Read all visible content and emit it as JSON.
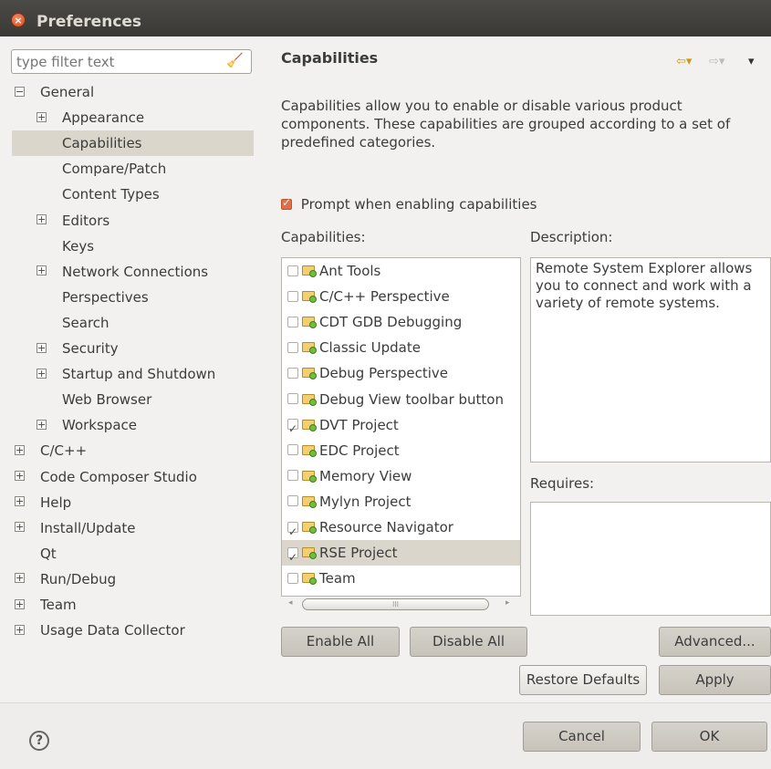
{
  "window": {
    "title": "Preferences"
  },
  "filter": {
    "placeholder": "type filter text"
  },
  "tree": [
    {
      "label": "General",
      "level": 0,
      "expander": "−",
      "selected": false
    },
    {
      "label": "Appearance",
      "level": 1,
      "expander": "+",
      "selected": false
    },
    {
      "label": "Capabilities",
      "level": 1,
      "expander": "",
      "selected": true
    },
    {
      "label": "Compare/Patch",
      "level": 1,
      "expander": "",
      "selected": false
    },
    {
      "label": "Content Types",
      "level": 1,
      "expander": "",
      "selected": false
    },
    {
      "label": "Editors",
      "level": 1,
      "expander": "+",
      "selected": false
    },
    {
      "label": "Keys",
      "level": 1,
      "expander": "",
      "selected": false
    },
    {
      "label": "Network Connections",
      "level": 1,
      "expander": "+",
      "selected": false
    },
    {
      "label": "Perspectives",
      "level": 1,
      "expander": "",
      "selected": false
    },
    {
      "label": "Search",
      "level": 1,
      "expander": "",
      "selected": false
    },
    {
      "label": "Security",
      "level": 1,
      "expander": "+",
      "selected": false
    },
    {
      "label": "Startup and Shutdown",
      "level": 1,
      "expander": "+",
      "selected": false
    },
    {
      "label": "Web Browser",
      "level": 1,
      "expander": "",
      "selected": false
    },
    {
      "label": "Workspace",
      "level": 1,
      "expander": "+",
      "selected": false
    },
    {
      "label": "C/C++",
      "level": 0,
      "expander": "+",
      "selected": false
    },
    {
      "label": "Code Composer Studio",
      "level": 0,
      "expander": "+",
      "selected": false
    },
    {
      "label": "Help",
      "level": 0,
      "expander": "+",
      "selected": false
    },
    {
      "label": "Install/Update",
      "level": 0,
      "expander": "+",
      "selected": false
    },
    {
      "label": "Qt",
      "level": 0,
      "expander": "",
      "selected": false
    },
    {
      "label": "Run/Debug",
      "level": 0,
      "expander": "+",
      "selected": false
    },
    {
      "label": "Team",
      "level": 0,
      "expander": "+",
      "selected": false
    },
    {
      "label": "Usage Data Collector",
      "level": 0,
      "expander": "+",
      "selected": false
    }
  ],
  "page": {
    "title": "Capabilities",
    "description": "Capabilities allow you to enable or disable various product components. These capabilities are grouped according to a set of predefined categories.",
    "prompt_checkbox": {
      "label": "Prompt when enabling capabilities",
      "checked": true
    },
    "capabilities_label": "Capabilities:",
    "description_label": "Description:",
    "requires_label": "Requires:",
    "description_text": "Remote System Explorer allows you to connect and work with a variety of remote systems.",
    "requires_text": ""
  },
  "capabilities": [
    {
      "label": "Ant Tools",
      "checked": false,
      "selected": false
    },
    {
      "label": "C/C++ Perspective",
      "checked": false,
      "selected": false
    },
    {
      "label": "CDT GDB Debugging",
      "checked": false,
      "selected": false
    },
    {
      "label": "Classic Update",
      "checked": false,
      "selected": false
    },
    {
      "label": "Debug Perspective",
      "checked": false,
      "selected": false
    },
    {
      "label": "Debug View toolbar button",
      "checked": false,
      "selected": false
    },
    {
      "label": "DVT Project",
      "checked": true,
      "selected": false
    },
    {
      "label": "EDC Project",
      "checked": false,
      "selected": false
    },
    {
      "label": "Memory View",
      "checked": false,
      "selected": false
    },
    {
      "label": "Mylyn Project",
      "checked": false,
      "selected": false
    },
    {
      "label": "Resource Navigator",
      "checked": true,
      "selected": false
    },
    {
      "label": "RSE Project",
      "checked": true,
      "selected": true
    },
    {
      "label": "Team",
      "checked": false,
      "selected": false
    }
  ],
  "buttons": {
    "enable_all": "Enable All",
    "disable_all": "Disable All",
    "advanced": "Advanced...",
    "restore_defaults": "Restore Defaults",
    "apply": "Apply",
    "cancel": "Cancel",
    "ok": "OK"
  },
  "colors": {
    "accent": "#e07048",
    "selection": "#dad6cc",
    "titlebar": "#3c3b37"
  }
}
